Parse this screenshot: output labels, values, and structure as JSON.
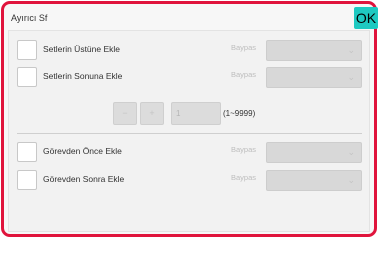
{
  "dialog": {
    "title": "Ayırıcı Sf",
    "ok_label": "OK"
  },
  "options": [
    {
      "label": "Setlerin Üstüne Ekle",
      "checked": false,
      "bypass_label": "Baypas"
    },
    {
      "label": "Setlerin Sonuna Ekle",
      "checked": false,
      "bypass_label": "Baypas"
    },
    {
      "label": "Görevden Önce Ekle",
      "checked": false,
      "bypass_label": "Baypas"
    },
    {
      "label": "Görevden Sonra Ekle",
      "checked": false,
      "bypass_label": "Baypas"
    }
  ],
  "count": {
    "value": "1",
    "range": "(1~9999)",
    "decrement_symbol": "−",
    "increment_symbol": "+"
  },
  "icons": {
    "dropdown": "chevron-down-icon"
  },
  "colors": {
    "frame_border": "#e0143c",
    "ok_button": "#1ec9c1"
  }
}
